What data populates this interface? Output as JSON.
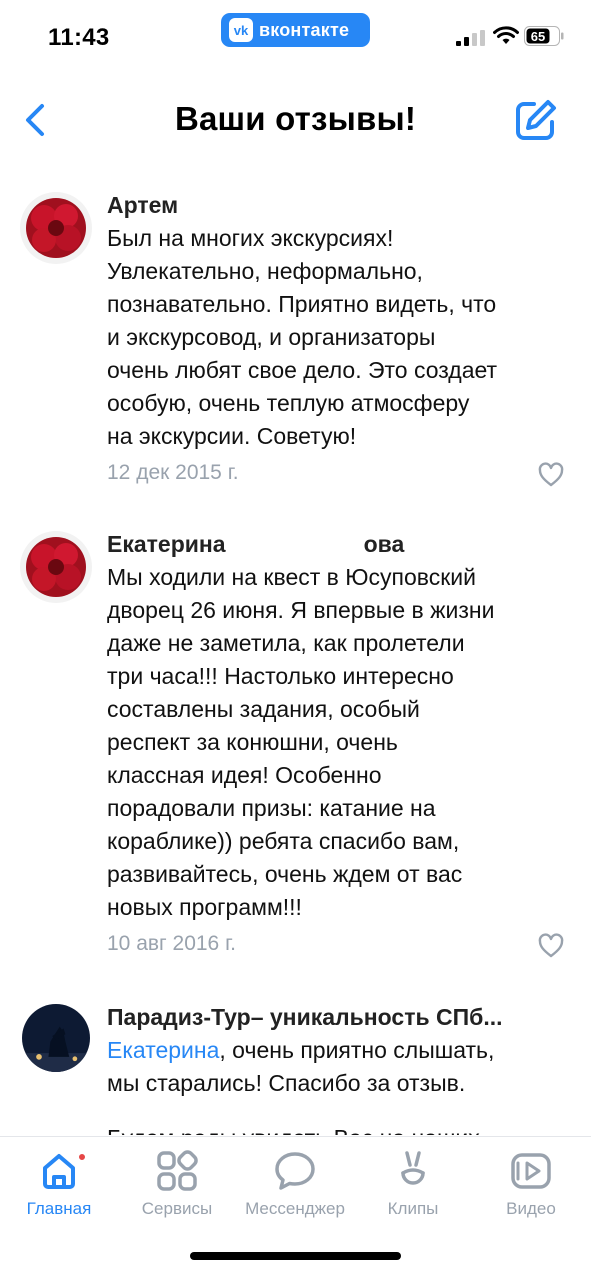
{
  "status_bar": {
    "time": "11:43",
    "app_pill_text": "вконтакте",
    "battery": "65"
  },
  "header": {
    "title": "Ваши отзывы!"
  },
  "reviews": [
    {
      "author": "Артем",
      "text": "Был на многих экскурсиях!\nУвлекательно, неформально,\nпознавательно. Приятно видеть, что\nи экскурсовод, и организаторы\nочень любят свое дело. Это создает\nособую, очень теплую атмосферу\nна экскурсии. Советую!",
      "date": "12 дек 2015 г."
    },
    {
      "author_first": "Екатерина",
      "author_last_suffix": "ова",
      "text": "Мы ходили на квест в Юсуповский\nдворец 26 июня. Я впервые в жизни\nдаже не заметила, как пролетели\nтри часа!!! Настолько интересно\nсоставлены задания, особый\nреспект за конюшни, очень\nклассная идея! Особенно\nпорадовали призы: катание на\nкораблике)) ребята спасибо вам,\nразвивайтесь, очень ждем от вас\nновых программ!!!",
      "date": "10 авг 2016 г."
    },
    {
      "author": "Парадиз-Тур– уникальность СПб...",
      "mention": "Екатерина",
      "text": ", очень приятно слышать,\nмы старались! Спасибо за отзыв.",
      "text_2": "Будем рады увидеть Вас на наших"
    }
  ],
  "tabs": [
    {
      "label": "Главная",
      "icon": "home-icon",
      "active": true
    },
    {
      "label": "Сервисы",
      "icon": "services-icon"
    },
    {
      "label": "Мессенджер",
      "icon": "messenger-icon"
    },
    {
      "label": "Клипы",
      "icon": "clips-icon"
    },
    {
      "label": "Видео",
      "icon": "video-icon"
    }
  ],
  "colors": {
    "accent": "#2787f5",
    "secondary_text": "#99a2ad",
    "notification_dot": "#e64646"
  }
}
